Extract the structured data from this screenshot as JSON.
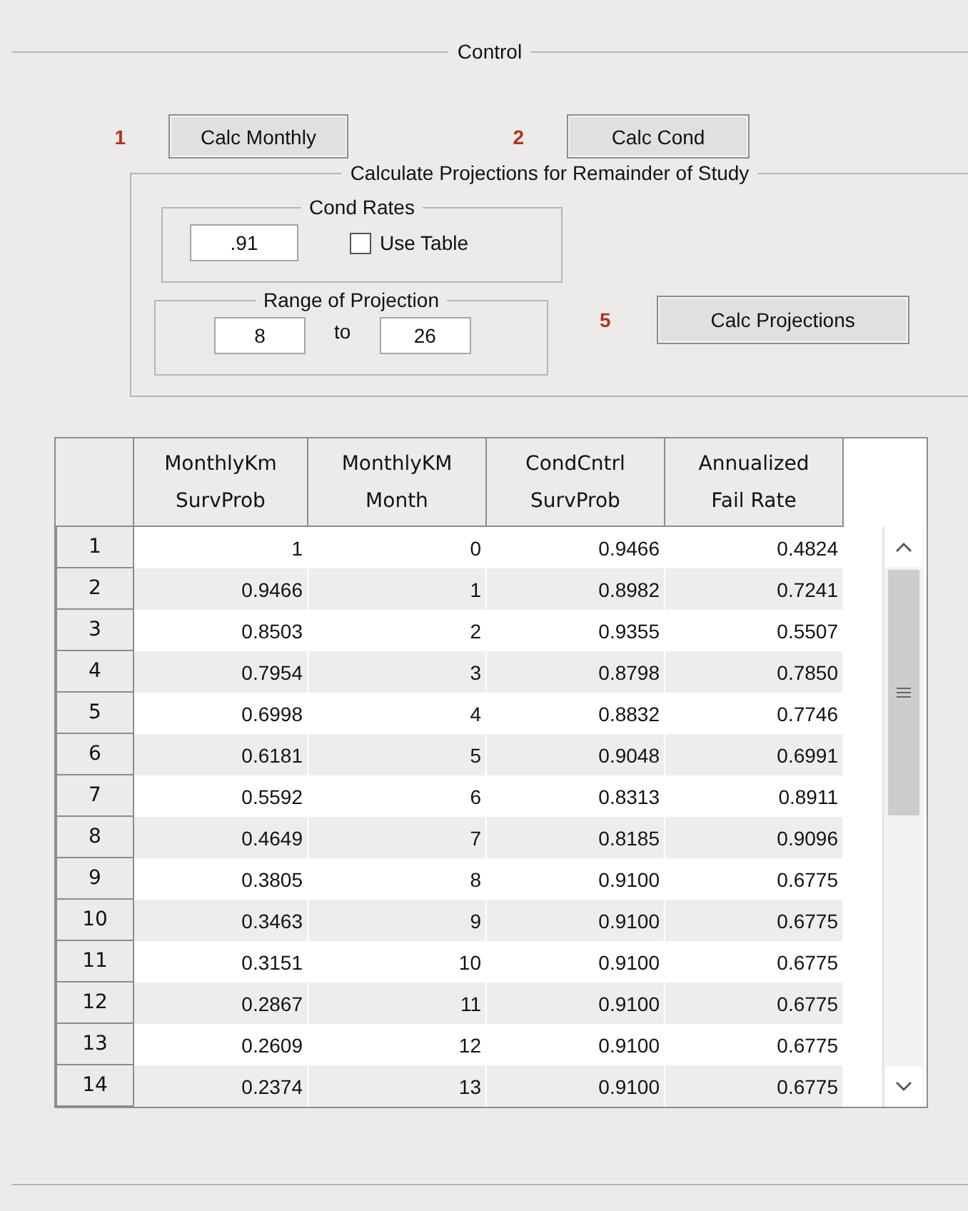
{
  "control": {
    "title": "Control",
    "steps": [
      {
        "number": "1",
        "button": "Calc Monthly"
      },
      {
        "number": "2",
        "button": "Calc Cond"
      }
    ],
    "projections": {
      "title": "Calculate Projections for Remainder of Study",
      "cond_rates": {
        "title": "Cond Rates",
        "value": ".91",
        "use_table": {
          "label": "Use Table",
          "checked": false
        }
      },
      "range": {
        "title": "Range of Projection",
        "from": "8",
        "separator": "to",
        "to": "26"
      },
      "step": {
        "number": "5",
        "button": "Calc Projections"
      }
    }
  },
  "table": {
    "columns": [
      {
        "lines": [
          "MonthlyKm",
          "SurvProb"
        ]
      },
      {
        "lines": [
          "MonthlyKM",
          "Month"
        ]
      },
      {
        "lines": [
          "CondCntrl",
          "SurvProb"
        ]
      },
      {
        "lines": [
          "Annualized",
          "Fail Rate"
        ]
      }
    ],
    "rows": [
      {
        "header": "1",
        "cells": [
          "1",
          "0",
          "0.9466",
          "0.4824"
        ]
      },
      {
        "header": "2",
        "cells": [
          "0.9466",
          "1",
          "0.8982",
          "0.7241"
        ]
      },
      {
        "header": "3",
        "cells": [
          "0.8503",
          "2",
          "0.9355",
          "0.5507"
        ]
      },
      {
        "header": "4",
        "cells": [
          "0.7954",
          "3",
          "0.8798",
          "0.7850"
        ]
      },
      {
        "header": "5",
        "cells": [
          "0.6998",
          "4",
          "0.8832",
          "0.7746"
        ]
      },
      {
        "header": "6",
        "cells": [
          "0.6181",
          "5",
          "0.9048",
          "0.6991"
        ]
      },
      {
        "header": "7",
        "cells": [
          "0.5592",
          "6",
          "0.8313",
          "0.8911"
        ]
      },
      {
        "header": "8",
        "cells": [
          "0.4649",
          "7",
          "0.8185",
          "0.9096"
        ]
      },
      {
        "header": "9",
        "cells": [
          "0.3805",
          "8",
          "0.9100",
          "0.6775"
        ]
      },
      {
        "header": "10",
        "cells": [
          "0.3463",
          "9",
          "0.9100",
          "0.6775"
        ]
      },
      {
        "header": "11",
        "cells": [
          "0.3151",
          "10",
          "0.9100",
          "0.6775"
        ]
      },
      {
        "header": "12",
        "cells": [
          "0.2867",
          "11",
          "0.9100",
          "0.6775"
        ]
      },
      {
        "header": "13",
        "cells": [
          "0.2609",
          "12",
          "0.9100",
          "0.6775"
        ]
      },
      {
        "header": "14",
        "cells": [
          "0.2374",
          "13",
          "0.9100",
          "0.6775"
        ]
      }
    ]
  }
}
